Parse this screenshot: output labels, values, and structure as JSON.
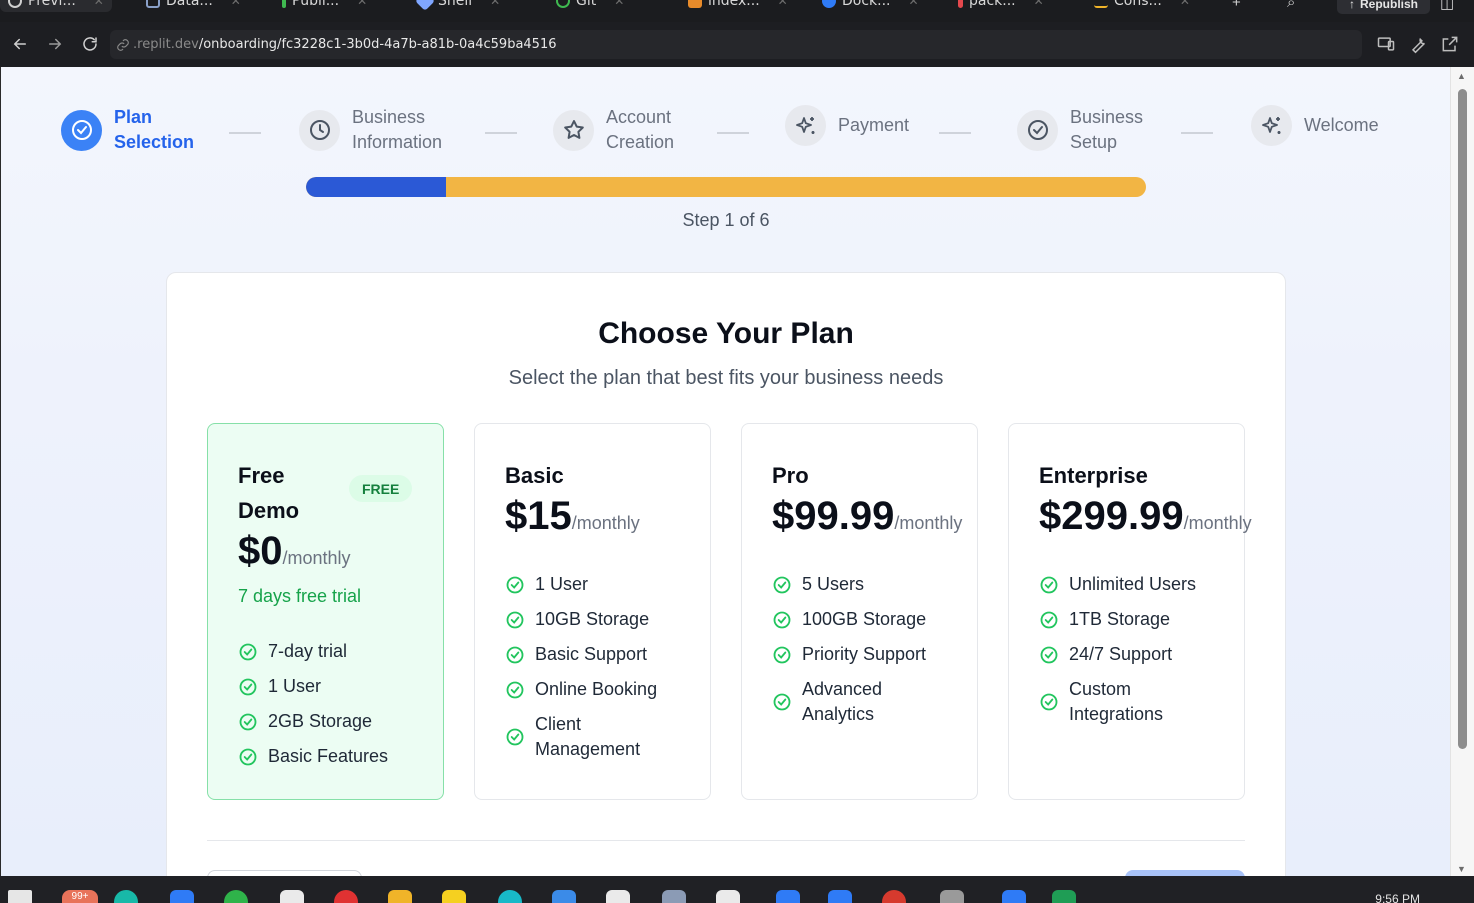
{
  "browser": {
    "tabs": [
      {
        "label": "Previ...",
        "color": "#d0d0d0"
      },
      {
        "label": "Data...",
        "color": "#8aa0c8"
      },
      {
        "label": "Publi...",
        "color": "#3fb950"
      },
      {
        "label": "Shell",
        "color": "#7fa6ff"
      },
      {
        "label": "Git",
        "color": "#3fb950"
      },
      {
        "label": "index...",
        "color": "#e88b2a"
      },
      {
        "label": "Dock...",
        "color": "#2f7bf6"
      },
      {
        "label": "pack...",
        "color": "#e5484d"
      },
      {
        "label": "Cons...",
        "color": "#f0b429"
      }
    ],
    "republish_label": "Republish",
    "url_domain": ".replit.dev",
    "url_path": "/onboarding/fc3228c1-3b0d-4a7b-a81b-0a4c59ba4516"
  },
  "stepper": {
    "steps": [
      {
        "label": "Plan Selection",
        "icon": "check-circle-icon",
        "active": true
      },
      {
        "label": "Business Information",
        "icon": "clock-icon",
        "active": false
      },
      {
        "label": "Account Creation",
        "icon": "star-icon",
        "active": false
      },
      {
        "label": "Payment",
        "icon": "sparkles-icon",
        "active": false
      },
      {
        "label": "Business Setup",
        "icon": "check-circle-icon",
        "active": false
      },
      {
        "label": "Welcome",
        "icon": "sparkles-icon",
        "active": false
      }
    ],
    "progress_fraction": 0.1667,
    "progress_color": "#2b59d6",
    "track_color": "#f2b544",
    "step_count": "Step 1 of 6"
  },
  "plans_card": {
    "title": "Choose Your Plan",
    "subtitle": "Select the plan that best fits your business needs",
    "plans": [
      {
        "name": "Free Demo",
        "badge": "FREE",
        "price": "$0",
        "period": "/monthly",
        "note": "7 days free trial",
        "selected": true,
        "features": [
          "7-day trial",
          "1 User",
          "2GB Storage",
          "Basic Features"
        ]
      },
      {
        "name": "Basic",
        "price": "$15",
        "period": "/monthly",
        "selected": false,
        "features": [
          "1 User",
          "10GB Storage",
          "Basic Support",
          "Online Booking",
          "Client Management"
        ]
      },
      {
        "name": "Pro",
        "price": "$99.99",
        "period": "/monthly",
        "selected": false,
        "features": [
          "5 Users",
          "100GB Storage",
          "Priority Support",
          "Advanced Analytics"
        ]
      },
      {
        "name": "Enterprise",
        "price": "$299.99",
        "period": "/monthly",
        "selected": false,
        "features": [
          "Unlimited Users",
          "1TB Storage",
          "24/7 Support",
          "Custom Integrations"
        ]
      }
    ]
  },
  "taskbar": {
    "badge": "99+",
    "clock": "9:56 PM"
  },
  "colors": {
    "accent": "#2563eb",
    "success": "#16a34a"
  }
}
